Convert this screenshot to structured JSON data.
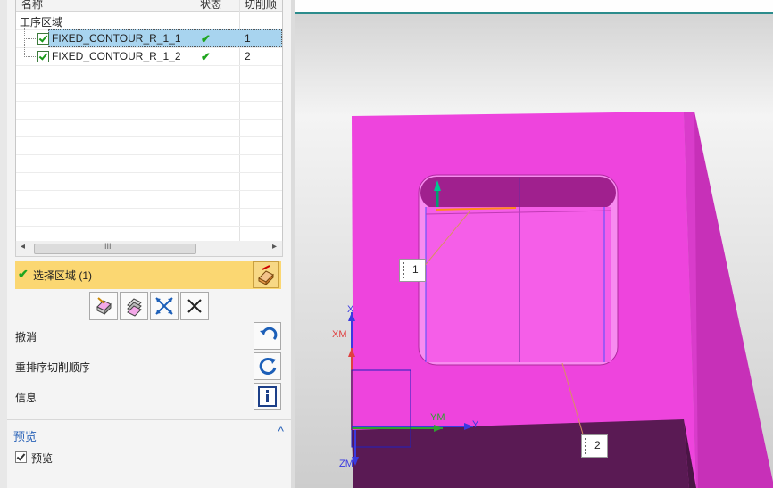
{
  "table": {
    "columns": [
      "名称",
      "状态",
      "切削顺"
    ],
    "group_label": "工序区域",
    "rows": [
      {
        "name": "FIXED_CONTOUR_R_1_1",
        "status": "✔",
        "order": "1"
      },
      {
        "name": "FIXED_CONTOUR_R_1_2",
        "status": "✔",
        "order": "2"
      }
    ],
    "scroll_left": "◂",
    "scroll_grip": "III",
    "scroll_right": "▸"
  },
  "selection": {
    "label": "选择区域 (1)",
    "check": "✔"
  },
  "actions": [
    {
      "label": "撤消"
    },
    {
      "label": "重排序切削顺序"
    },
    {
      "label": "信息"
    }
  ],
  "preview": {
    "title": "预览",
    "checkbox_label": "预览",
    "chevron": "^"
  },
  "viewport": {
    "callouts": [
      "1",
      "2"
    ],
    "axes": {
      "x": "X",
      "xm": "XM",
      "y": "Y",
      "ym": "YM",
      "zm": "ZM"
    }
  },
  "colors": {
    "part": "#ee44dd",
    "selection_bar": "#fbd772",
    "row_highlight": "#a8d4ef"
  }
}
